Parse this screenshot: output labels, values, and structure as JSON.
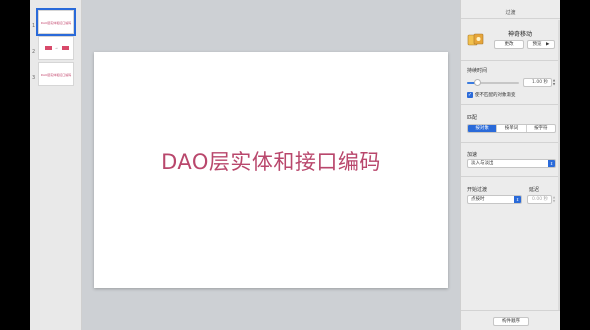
{
  "sidebar": {
    "slides": [
      {
        "number": "1",
        "text": "DAO层实体和接口编码"
      },
      {
        "number": "2",
        "text": "→"
      },
      {
        "number": "3",
        "text": "DAO层实体和接口编码"
      }
    ]
  },
  "slide": {
    "title": "DAO层实体和接口编码"
  },
  "inspector": {
    "panel_title": "过渡",
    "effect_name": "神奇移动",
    "change_button": "更改",
    "preview_button": "预览",
    "duration_label": "持续时间",
    "duration_value": "1.00 秒",
    "duration_fraction": 0.2,
    "fade_checkbox_label": "使不匹配的对象渐变",
    "fade_checked": true,
    "match_label": "匹配",
    "match_options": [
      "按对象",
      "按单词",
      "按字符"
    ],
    "match_selected": 0,
    "acceleration_label": "加速",
    "acceleration_value": "淡入与淡出",
    "start_transition_label": "开始过渡",
    "start_transition_value": "点按时",
    "delay_label": "延迟",
    "delay_value": "0.00 秒",
    "build_order_button": "构件顺序"
  },
  "colors": {
    "accent": "#2a6ad9",
    "slide_title": "#b9476c",
    "canvas_bg": "#cdd0d4"
  }
}
